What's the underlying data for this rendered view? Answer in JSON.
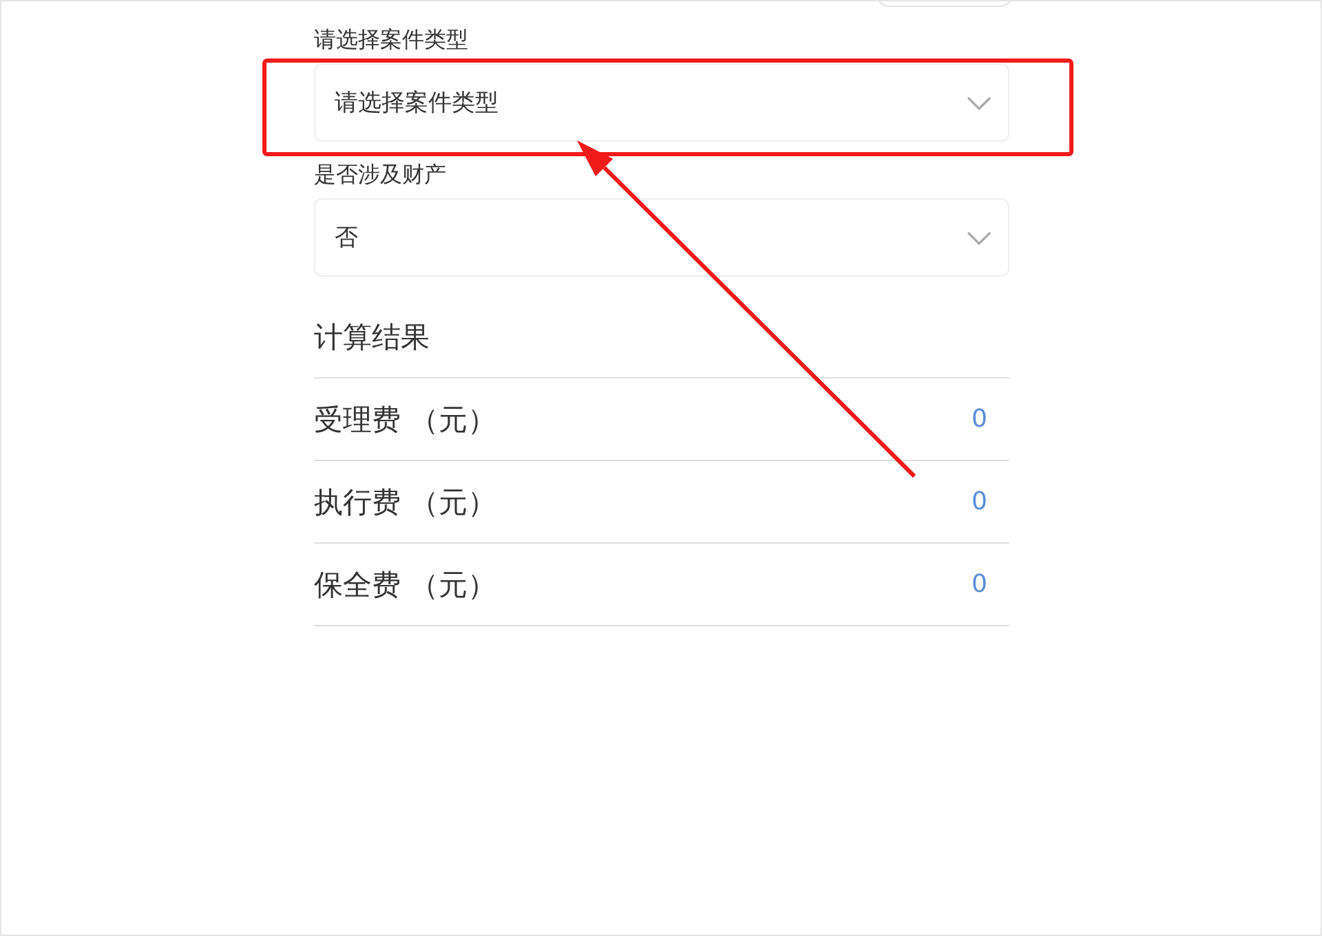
{
  "fields": [
    {
      "label": "请选择案件类型",
      "placeholder": "请选择案件类型"
    },
    {
      "label": "是否涉及财产",
      "value": "否"
    }
  ],
  "results": {
    "title": "计算结果",
    "rows": [
      {
        "name": "受理费 （元）",
        "value": "0"
      },
      {
        "name": "执行费 （元）",
        "value": "0"
      },
      {
        "name": "保全费 （元）",
        "value": "0"
      }
    ]
  },
  "annotations": [
    {
      "kind": "highlight-box"
    },
    {
      "kind": "arrow"
    }
  ]
}
